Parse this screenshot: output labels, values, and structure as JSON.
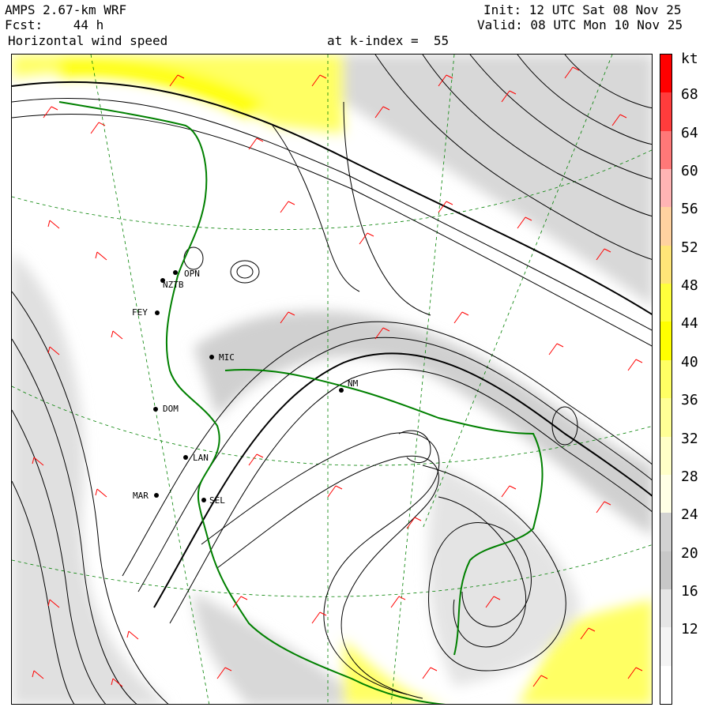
{
  "header": {
    "model_line": "AMPS 2.67-km WRF",
    "forecast_line": "Fcst:    44 h",
    "field_line": "Horizontal wind speed",
    "level_line": "at k-index =  55",
    "init_line": "Init: 12 UTC Sat 08 Nov 25",
    "valid_line": "Valid: 08 UTC Mon 10 Nov 25"
  },
  "colorbar": {
    "unit": "kt",
    "labels": [
      "68",
      "64",
      "60",
      "56",
      "52",
      "48",
      "44",
      "40",
      "36",
      "32",
      "28",
      "24",
      "20",
      "16",
      "12"
    ],
    "bins": [
      {
        "upper": 72,
        "color": "#ff0000"
      },
      {
        "upper": 68,
        "color": "#ff3c3c"
      },
      {
        "upper": 64,
        "color": "#ff7878"
      },
      {
        "upper": 60,
        "color": "#ffb4b4"
      },
      {
        "upper": 56,
        "color": "#ffd2a0"
      },
      {
        "upper": 52,
        "color": "#ffe678"
      },
      {
        "upper": 48,
        "color": "#ffff3c"
      },
      {
        "upper": 44,
        "color": "#ffff00"
      },
      {
        "upper": 40,
        "color": "#ffff64"
      },
      {
        "upper": 36,
        "color": "#ffff96"
      },
      {
        "upper": 32,
        "color": "#ffffc8"
      },
      {
        "upper": 28,
        "color": "#ffffe6"
      },
      {
        "upper": 24,
        "color": "#d2d2d2"
      },
      {
        "upper": 20,
        "color": "#c8c8c8"
      },
      {
        "upper": 16,
        "color": "#e6e6e6"
      },
      {
        "upper": 12,
        "color": "#f4f4f4"
      },
      {
        "upper": 8,
        "color": "#ffffff"
      }
    ]
  },
  "stations": [
    {
      "code": "OPN"
    },
    {
      "code": "NZTB"
    },
    {
      "code": "FEY"
    },
    {
      "code": "MIC"
    },
    {
      "code": "DOM"
    },
    {
      "code": "LAN"
    },
    {
      "code": "MAR"
    },
    {
      "code": "SEL"
    },
    {
      "code": "NM"
    }
  ],
  "colors": {
    "coastline": "#008000",
    "barbs": "#ff0000",
    "streamlines": "#000000",
    "graticule": "#008000"
  }
}
